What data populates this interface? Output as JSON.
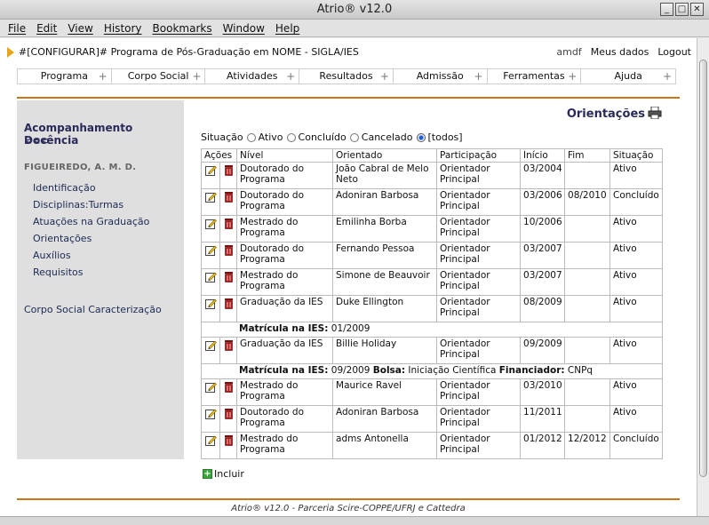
{
  "window": {
    "title": "Atrio® v12.0"
  },
  "menu": [
    "File",
    "Edit",
    "View",
    "History",
    "Bookmarks",
    "Window",
    "Help"
  ],
  "header": {
    "page_title": "#[CONFIGURAR]# Programa de Pós-Graduação em NOME - SIGLA/IES",
    "user": "amdf",
    "my_data": "Meus dados",
    "logout": "Logout"
  },
  "nav": [
    "Programa",
    "Corpo Social",
    "Atividades",
    "Resultados",
    "Admissão",
    "Ferramentas",
    "Ajuda"
  ],
  "sidebar": {
    "title": "Acompanhamento Docência",
    "back": "<<<",
    "person": "FIGUEIREDO, A. M. D.",
    "links": [
      "Identificação",
      "Disciplinas:Turmas",
      "Atuações na Graduação",
      "Orientações",
      "Auxílios",
      "Requisitos"
    ],
    "footer_link": "Corpo Social Caracterização"
  },
  "section": {
    "title": "Orientações"
  },
  "filter": {
    "label": "Situação",
    "options": [
      "Ativo",
      "Concluído",
      "Cancelado",
      "[todos]"
    ],
    "selected": "[todos]"
  },
  "table": {
    "headers": [
      "Ações",
      "Nível",
      "Orientado",
      "Participação",
      "Início",
      "Fim",
      "Situação"
    ],
    "rows": [
      {
        "nivel": "Doutorado do Programa",
        "orientado": "João Cabral de Melo Neto",
        "participacao": "Orientador Principal",
        "inicio": "03/2004",
        "fim": "",
        "situacao": "Ativo"
      },
      {
        "nivel": "Doutorado do Programa",
        "orientado": "Adoniran Barbosa",
        "participacao": "Orientador Principal",
        "inicio": "03/2006",
        "fim": "08/2010",
        "situacao": "Concluído"
      },
      {
        "nivel": "Mestrado do Programa",
        "orientado": "Emilinha Borba",
        "participacao": "Orientador Principal",
        "inicio": "10/2006",
        "fim": "",
        "situacao": "Ativo"
      },
      {
        "nivel": "Doutorado do Programa",
        "orientado": "Fernando Pessoa",
        "participacao": "Orientador Principal",
        "inicio": "03/2007",
        "fim": "",
        "situacao": "Ativo"
      },
      {
        "nivel": "Mestrado do Programa",
        "orientado": "Simone de Beauvoir",
        "participacao": "Orientador Principal",
        "inicio": "03/2007",
        "fim": "",
        "situacao": "Ativo"
      },
      {
        "nivel": "Graduação da IES",
        "orientado": "Duke Ellington",
        "participacao": "Orientador Principal",
        "inicio": "08/2009",
        "fim": "",
        "situacao": "Ativo"
      },
      {
        "nivel": "Graduação da IES",
        "orientado": "Billie Holiday",
        "participacao": "Orientador Principal",
        "inicio": "09/2009",
        "fim": "",
        "situacao": "Ativo"
      },
      {
        "nivel": "Mestrado do Programa",
        "orientado": "Maurice Ravel",
        "participacao": "Orientador Principal",
        "inicio": "03/2010",
        "fim": "",
        "situacao": "Ativo"
      },
      {
        "nivel": "Doutorado do Programa",
        "orientado": "Adoniran Barbosa",
        "participacao": "Orientador Principal",
        "inicio": "11/2011",
        "fim": "",
        "situacao": "Ativo"
      },
      {
        "nivel": "Mestrado do Programa",
        "orientado": "adms Antonella",
        "participacao": "Orientador Principal",
        "inicio": "01/2012",
        "fim": "12/2012",
        "situacao": "Concluído"
      }
    ],
    "extra1": {
      "k1": "Matrícula na IES:",
      "v1": " 01/2009"
    },
    "extra2": {
      "k1": "Matrícula na IES:",
      "v1": " 09/2009 ",
      "k2": "Bolsa:",
      "v2": " Iniciação Científica ",
      "k3": "Financiador:",
      "v3": " CNPq"
    }
  },
  "actions": {
    "include": "Incluir"
  },
  "footer": {
    "text": "Atrio® v12.0  -  Parceria Scire-COPPE/UFRJ e Cattedra"
  },
  "icons": [
    "edit-icon",
    "trash-icon",
    "printer-icon",
    "plus-icon",
    "arrow-right-icon"
  ],
  "colors": {
    "accent": "#c8761a",
    "sidebar_bg": "#dfdfdf",
    "link": "#1c2a55",
    "warning_arrow": "#e8a417"
  }
}
